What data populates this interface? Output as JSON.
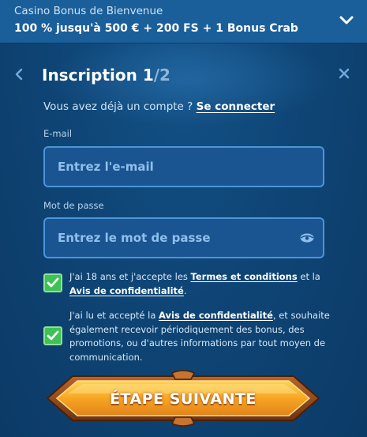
{
  "bonus": {
    "title": "Casino Bonus de Bienvenue",
    "offer": "100 % jusqu'à 500 € + 200 FS + 1 Bonus Crab"
  },
  "form": {
    "title": "Inscription 1",
    "step_total": "/2",
    "login_prompt": "Vous avez déjà un compte ?",
    "login_link": "Se connecter",
    "email": {
      "label": "E-mail",
      "placeholder": "Entrez l'e-mail",
      "value": ""
    },
    "password": {
      "label": "Mot de passe",
      "placeholder": "Entrez le mot de passe",
      "value": ""
    },
    "consent_terms": {
      "checked": true,
      "text_before": "J'ai 18 ans et j'accepte les ",
      "terms_link": "Termes et conditions",
      "text_middle": " et la ",
      "privacy_link": "Avis de confidentialité",
      "text_after": "."
    },
    "consent_marketing": {
      "checked": true,
      "text_before": "J'ai lu et accepté la ",
      "privacy_link": "Avis de confidentialité",
      "text_after": ", et souhaite également recevoir périodiquement des bonus, des promotions, ou d'autres informations par tout moyen de communication."
    },
    "next_button": "ÉTAPE SUIVANTE"
  },
  "colors": {
    "background": "#0d3a66",
    "bonus_bar": "#1a5f9a",
    "input_border": "#4a95d8",
    "checkbox": "#3ec254",
    "button": "#f7a623"
  },
  "icons": {
    "expand": "chevron-down-icon",
    "back": "chevron-left-icon",
    "close": "close-icon",
    "show_password": "eye-icon",
    "check": "checkmark-icon"
  }
}
